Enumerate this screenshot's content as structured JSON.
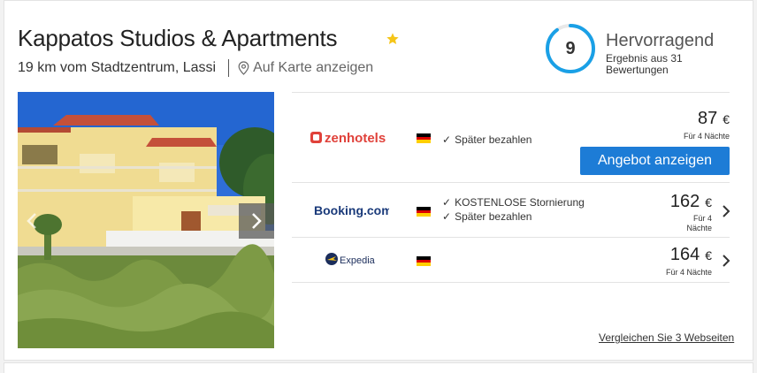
{
  "hotel": {
    "name": "Kappatos Studios & Apartments",
    "star_icon": "star-icon",
    "distance": "19 km vom Stadtzentrum, Lassi",
    "map_link": "Auf Karte anzeigen"
  },
  "rating": {
    "score": "9",
    "label": "Hervorragend",
    "sub": "Ergebnis aus 31 Bewertungen",
    "fraction": 0.9,
    "color": "#1aa0e6"
  },
  "offers": [
    {
      "provider": "zenhotels",
      "features": [
        "Später bezahlen"
      ],
      "price": "87",
      "currency": "€",
      "nights": "Für 4 Nächte",
      "cta": "Angebot anzeigen"
    },
    {
      "provider": "Booking.com",
      "features": [
        "KOSTENLOSE Stornierung",
        "Später bezahlen"
      ],
      "price": "162",
      "currency": "€",
      "nights_line1": "Für 4",
      "nights_line2": "Nächte"
    },
    {
      "provider": "Expedia",
      "features": [],
      "price": "164",
      "currency": "€",
      "nights": "Für 4 Nächte"
    }
  ],
  "compare_link": "Vergleichen Sie 3 Webseiten",
  "colors": {
    "accent": "#1d7cd6",
    "star": "#f5c518"
  }
}
